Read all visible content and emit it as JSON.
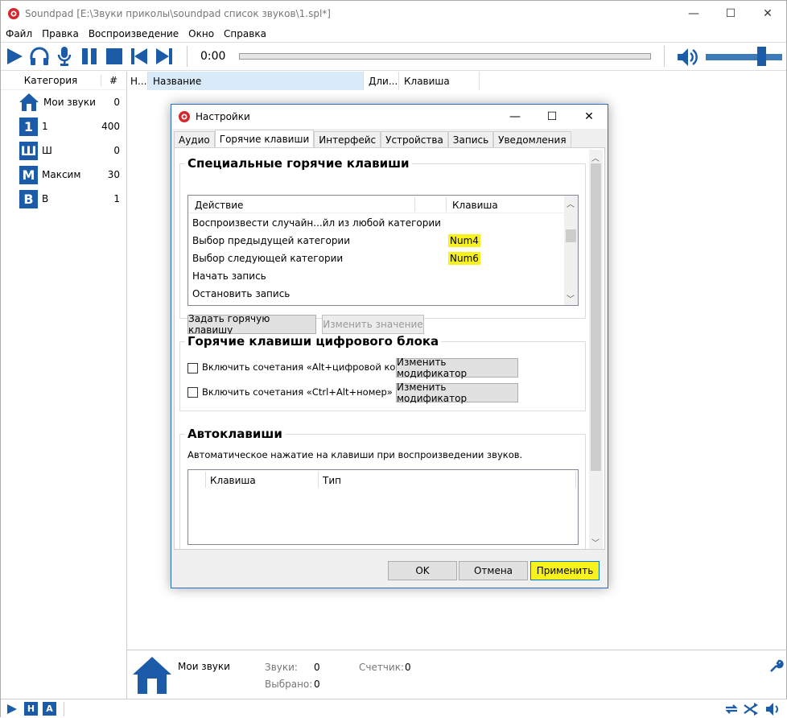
{
  "window": {
    "title": "Soundpad [E:\\Звуки приколы\\soundpad список звуков\\1.spl*]",
    "minimize": "—",
    "maximize": "☐",
    "close": "✕"
  },
  "menu": [
    "Файл",
    "Правка",
    "Воспроизведение",
    "Окно",
    "Справка"
  ],
  "player": {
    "time": "0:00",
    "volume_percent": 73,
    "accent": "#1c5ba7"
  },
  "categories": {
    "header_name": "Категория",
    "header_count": "#",
    "items": [
      {
        "badge": "",
        "label": "Мои звуки",
        "count": "0",
        "icon": "home-icon"
      },
      {
        "badge": "1",
        "label": "1",
        "count": "400"
      },
      {
        "badge": "Ш",
        "label": "Ш",
        "count": "0"
      },
      {
        "badge": "М",
        "label": "Максим",
        "count": "30"
      },
      {
        "badge": "В",
        "label": "В",
        "count": "1"
      }
    ]
  },
  "list_header": [
    "Н...",
    "Название",
    "Дли...",
    "Клавиша"
  ],
  "info": {
    "category": "Мои звуки",
    "sounds_label": "Звуки:",
    "sounds_value": "0",
    "selected_label": "Выбрано:",
    "selected_value": "0",
    "counter_label": "Счетчик:",
    "counter_value": "0"
  },
  "statusbar": {
    "badge_h": "H",
    "badge_a": "A"
  },
  "dialog": {
    "title": "Настройки",
    "tabs": [
      "Аудио",
      "Горячие клавиши",
      "Интерфейс",
      "Устройства",
      "Запись",
      "Уведомления"
    ],
    "active_tab": "Горячие клавиши",
    "special": {
      "title": "Специальные горячие клавиши",
      "col_action": "Действие",
      "col_key": "Клавиша",
      "rows": [
        {
          "action": "Воспроизвести случайн...йл из любой категории",
          "key": ""
        },
        {
          "action": "Выбор предыдущей категории",
          "key": "Num4"
        },
        {
          "action": "Выбор следующей категории",
          "key": "Num6"
        },
        {
          "action": "Начать запись",
          "key": ""
        },
        {
          "action": "Остановить запись",
          "key": ""
        }
      ],
      "set_button": "Задать горячую клавишу",
      "change_button": "Изменить значение"
    },
    "numpad": {
      "title": "Горячие клавиши цифрового блока",
      "opt1": "Включить сочетания «Alt+цифровой код»",
      "opt2": "Включить сочетания «Ctrl+Alt+номер»",
      "modifier_button": "Изменить модификатор"
    },
    "autokeys": {
      "title": "Автоклавиши",
      "description": "Автоматическое нажатие на клавиши при воспроизведении звуков.",
      "col_key": "Клавиша",
      "col_type": "Тип"
    },
    "ok": "OK",
    "cancel": "Отмена",
    "apply": "Применить",
    "highlight": "#f7f11e"
  }
}
